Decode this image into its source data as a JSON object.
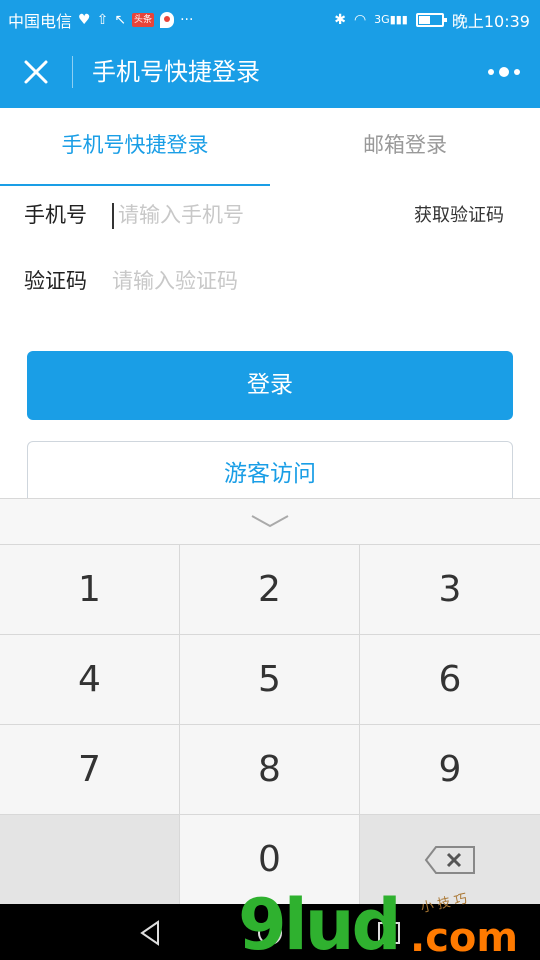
{
  "status_bar": {
    "carrier": "中国电信",
    "badge_text": "头条",
    "signal_text": "3G",
    "time": "晚上10:39",
    "battery_level": 0.5
  },
  "title_bar": {
    "title": "手机号快捷登录"
  },
  "tabs": [
    {
      "label": "手机号快捷登录",
      "active": true
    },
    {
      "label": "邮箱登录",
      "active": false
    }
  ],
  "form": {
    "phone_label": "手机号",
    "phone_placeholder": "请输入手机号",
    "get_code_label": "获取验证码",
    "code_label": "验证码",
    "code_placeholder": "请输入验证码"
  },
  "buttons": {
    "login": "登录",
    "guest": "游客访问"
  },
  "keypad": {
    "keys": [
      "1",
      "2",
      "3",
      "4",
      "5",
      "6",
      "7",
      "8",
      "9",
      "",
      "0",
      "delete"
    ]
  },
  "watermark": {
    "main": "9lud",
    "suffix": ".com",
    "small": "小技巧"
  },
  "colors": {
    "accent": "#1a9ee6",
    "placeholder": "#c8c8c8"
  }
}
